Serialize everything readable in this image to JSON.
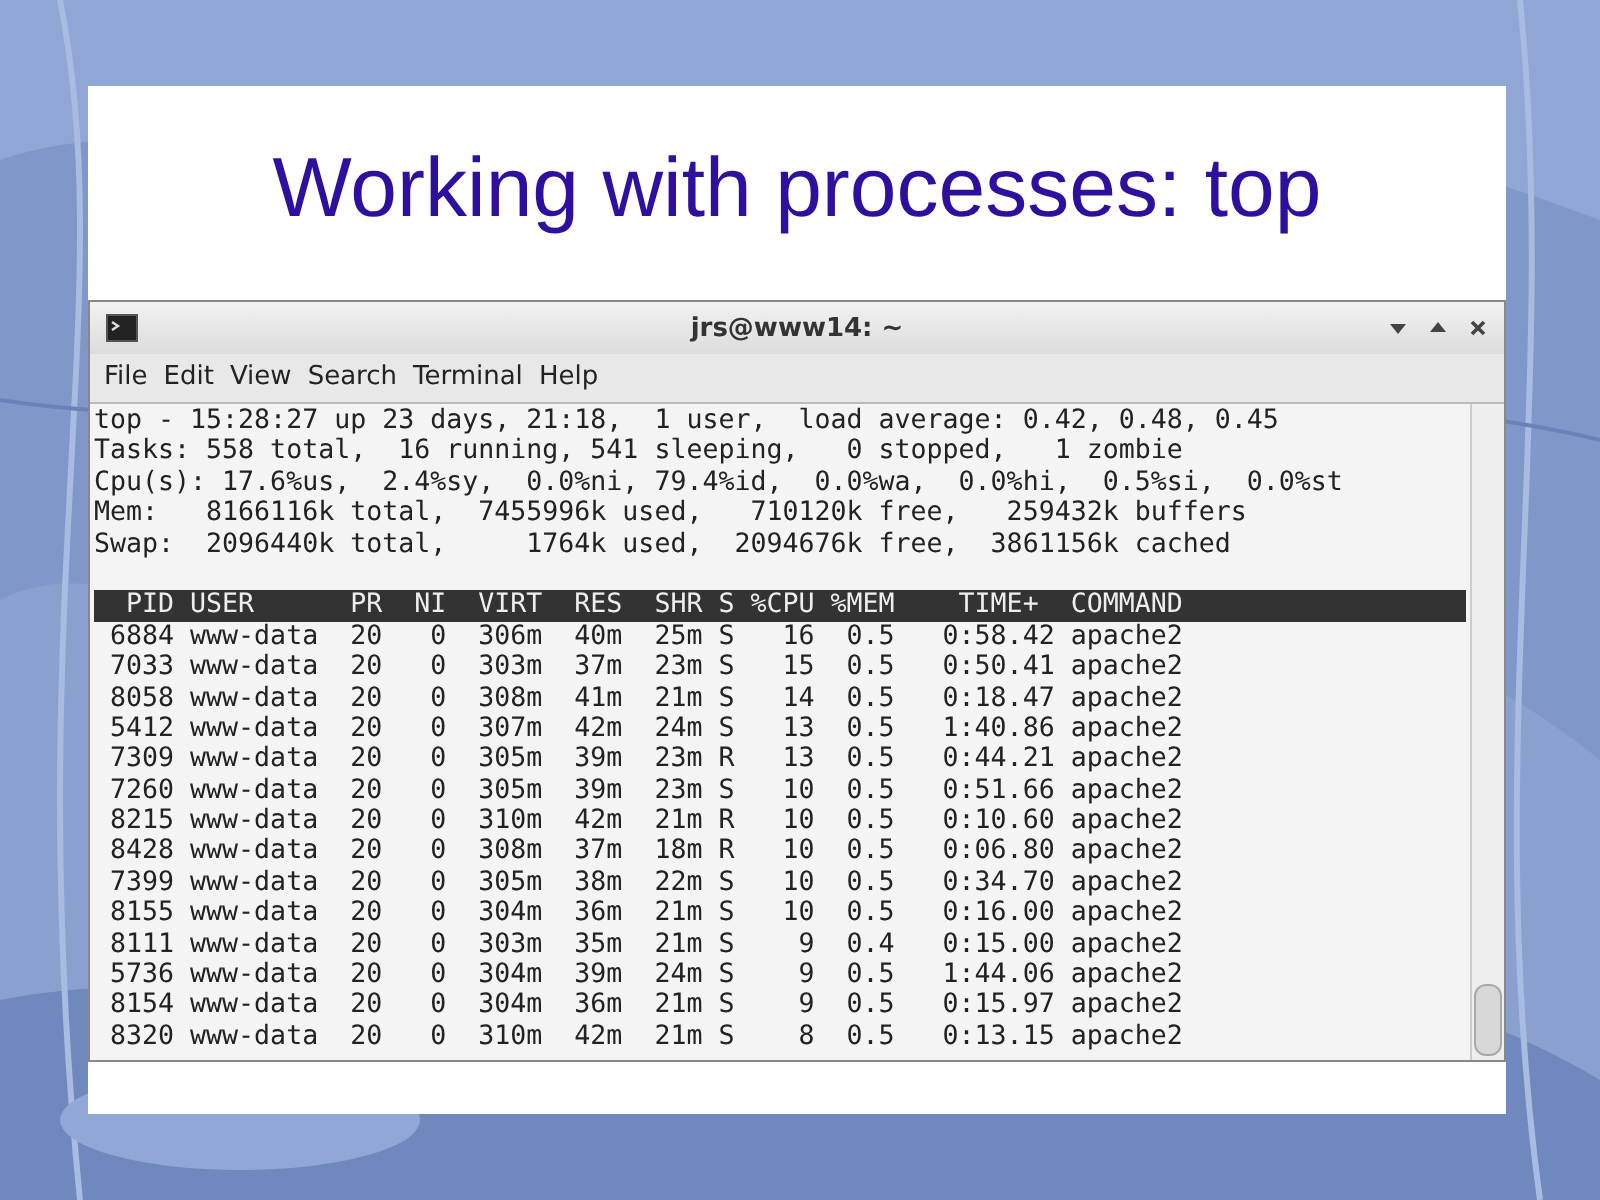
{
  "slide": {
    "title": "Working with processes: top"
  },
  "window": {
    "title": "jrs@www14: ~"
  },
  "menu": [
    "File",
    "Edit",
    "View",
    "Search",
    "Terminal",
    "Help"
  ],
  "summary": [
    "top - 15:28:27 up 23 days, 21:18,  1 user,  load average: 0.42, 0.48, 0.45",
    "Tasks: 558 total,  16 running, 541 sleeping,   0 stopped,   1 zombie",
    "Cpu(s): 17.6%us,  2.4%sy,  0.0%ni, 79.4%id,  0.0%wa,  0.0%hi,  0.5%si,  0.0%st",
    "Mem:   8166116k total,  7455996k used,   710120k free,   259432k buffers",
    "Swap:  2096440k total,     1764k used,  2094676k free,  3861156k cached"
  ],
  "table": {
    "header": "  PID USER      PR  NI  VIRT  RES  SHR S %CPU %MEM    TIME+  COMMAND",
    "rows": [
      " 6884 www-data  20   0  306m  40m  25m S   16  0.5   0:58.42 apache2",
      " 7033 www-data  20   0  303m  37m  23m S   15  0.5   0:50.41 apache2",
      " 8058 www-data  20   0  308m  41m  21m S   14  0.5   0:18.47 apache2",
      " 5412 www-data  20   0  307m  42m  24m S   13  0.5   1:40.86 apache2",
      " 7309 www-data  20   0  305m  39m  23m R   13  0.5   0:44.21 apache2",
      " 7260 www-data  20   0  305m  39m  23m S   10  0.5   0:51.66 apache2",
      " 8215 www-data  20   0  310m  42m  21m R   10  0.5   0:10.60 apache2",
      " 8428 www-data  20   0  308m  37m  18m R   10  0.5   0:06.80 apache2",
      " 7399 www-data  20   0  305m  38m  22m S   10  0.5   0:34.70 apache2",
      " 8155 www-data  20   0  304m  36m  21m S   10  0.5   0:16.00 apache2",
      " 8111 www-data  20   0  303m  35m  21m S    9  0.4   0:15.00 apache2",
      " 5736 www-data  20   0  304m  39m  24m S    9  0.5   1:44.06 apache2",
      " 8154 www-data  20   0  304m  36m  21m S    9  0.5   0:15.97 apache2",
      " 8320 www-data  20   0  310m  42m  21m S    8  0.5   0:13.15 apache2"
    ]
  }
}
